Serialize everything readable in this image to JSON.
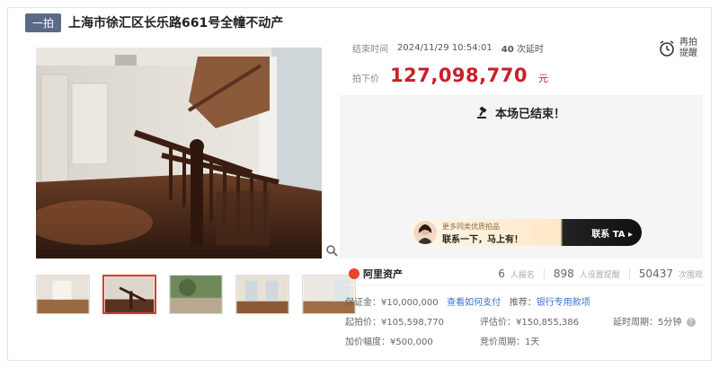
{
  "header": {
    "tag": "一拍",
    "title": "上海市徐汇区长乐路661号全幢不动产"
  },
  "auction": {
    "end_label": "结束时间",
    "end_time": "2024/11/29 10:54:01",
    "delay_count": "40",
    "delay_text": "次延时",
    "price_label": "拍下价",
    "price": "127,098,770",
    "price_unit": "元",
    "remind_label": "再拍提醒",
    "ended_message": "本场已结束！"
  },
  "promo": {
    "line1": "更多同类优质拍品",
    "line2": "联系一下，马上有！",
    "button": "联系 TA ▸"
  },
  "stats": {
    "brand": "阿里资产",
    "signups": "6",
    "signups_label": "人报名",
    "reminders": "898",
    "reminders_label": "人设置提醒",
    "views": "50437",
    "views_label": "次围观"
  },
  "details": {
    "deposit_label": "保证金：",
    "deposit": "¥10,000,000",
    "payment_link": "查看如何支付",
    "recommend_label": "推荐：",
    "recommend_link": "银行专用款项",
    "start_price_label": "起拍价：",
    "start_price": "¥105,598,770",
    "appraisal_label": "评估价：",
    "appraisal": "¥150,855,386",
    "delay_period_label": "延时周期：",
    "delay_period": "5分钟",
    "increment_label": "加价幅度：",
    "increment": "¥500,000",
    "bid_period_label": "竞价周期：",
    "bid_period": "1天"
  },
  "colors": {
    "accent_red": "#c8202a",
    "link_blue": "#3a6fd0",
    "tag_bg": "#5b6a86"
  }
}
